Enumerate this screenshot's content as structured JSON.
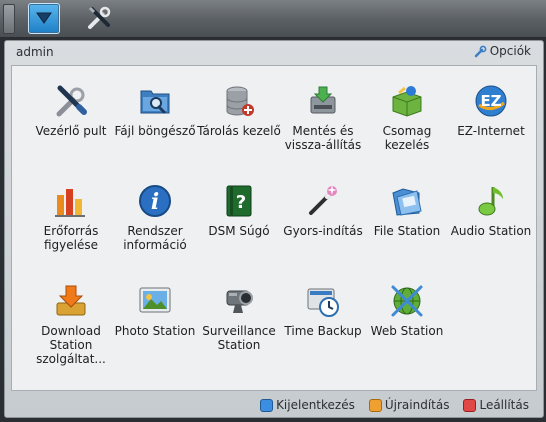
{
  "panel": {
    "user": "admin",
    "options_label": "Opciók"
  },
  "apps": [
    {
      "label": "Vezérlő pult",
      "icon": "control-panel-icon"
    },
    {
      "label": "Fájl böngésző",
      "icon": "file-browser-icon"
    },
    {
      "label": "Tárolás kezelő",
      "icon": "storage-manager-icon"
    },
    {
      "label": "Mentés és vissza-állítás",
      "icon": "backup-restore-icon"
    },
    {
      "label": "Csomag kezelés",
      "icon": "package-manager-icon"
    },
    {
      "label": "EZ-Internet",
      "icon": "ez-internet-icon"
    },
    {
      "label": "Erőforrás figyelése",
      "icon": "resource-monitor-icon"
    },
    {
      "label": "Rendszer információ",
      "icon": "system-info-icon"
    },
    {
      "label": "DSM Súgó",
      "icon": "help-icon"
    },
    {
      "label": "Gyors-indítás",
      "icon": "quick-start-icon"
    },
    {
      "label": "File Station",
      "icon": "file-station-icon"
    },
    {
      "label": "Audio Station",
      "icon": "audio-station-icon"
    },
    {
      "label": "Download Station szolgáltat...",
      "icon": "download-station-icon"
    },
    {
      "label": "Photo Station",
      "icon": "photo-station-icon"
    },
    {
      "label": "Surveillance Station",
      "icon": "surveillance-station-icon"
    },
    {
      "label": "Time Backup",
      "icon": "time-backup-icon"
    },
    {
      "label": "Web Station",
      "icon": "web-station-icon"
    }
  ],
  "footer": {
    "logout": "Kijelentkezés",
    "restart": "Újraindítás",
    "shutdown": "Leállítás",
    "colors": {
      "logout": "#3b8ee0",
      "restart": "#f0a030",
      "shutdown": "#e04848"
    }
  }
}
